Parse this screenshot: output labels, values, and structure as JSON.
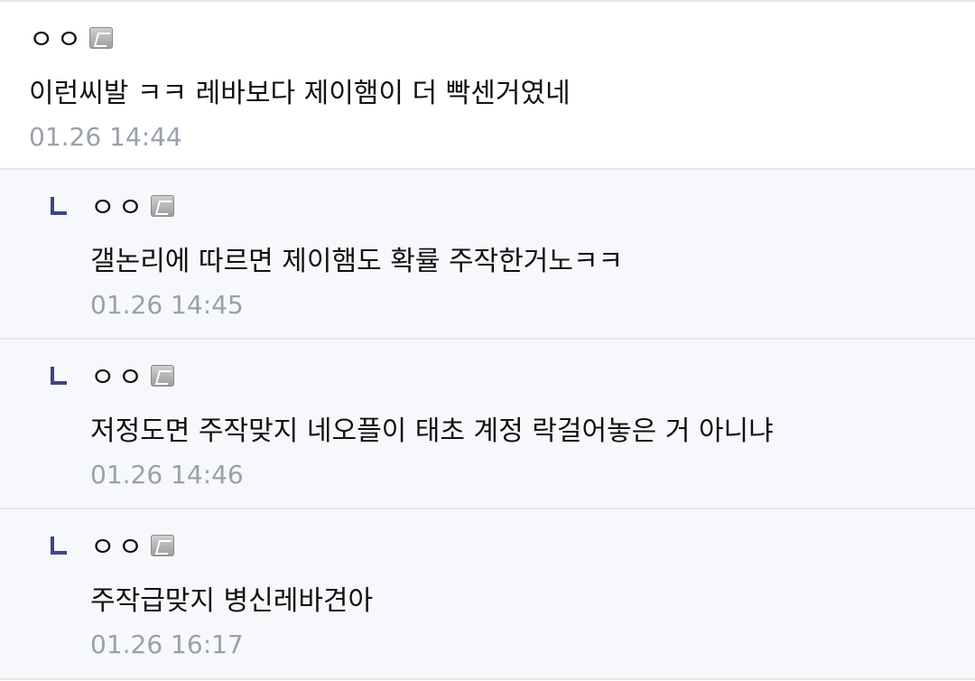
{
  "comments": [
    {
      "nick": "ㅇㅇ",
      "text": "이런씨발 ㅋㅋ 레바보다 제이햄이 더 빡센거였네",
      "time": "01.26 14:44"
    },
    {
      "nick": "ㅇㅇ",
      "text": "갤논리에 따르면 제이햄도 확률 주작한거노ㅋㅋ",
      "time": "01.26 14:45"
    },
    {
      "nick": "ㅇㅇ",
      "text": "저정도면 주작맞지 네오플이 태초 계정 락걸어놓은 거 아니냐",
      "time": "01.26 14:46"
    },
    {
      "nick": "ㅇㅇ",
      "text": "주작급맞지 병신레바견아",
      "time": "01.26 16:17"
    }
  ],
  "colors": {
    "reply_bg": "#f7f8fb",
    "reply_mark": "#3c468c",
    "time": "#9aa0ac"
  },
  "icons": {
    "badge": "fixed-nick-badge-icon",
    "reply": "reply-arrow-icon"
  }
}
